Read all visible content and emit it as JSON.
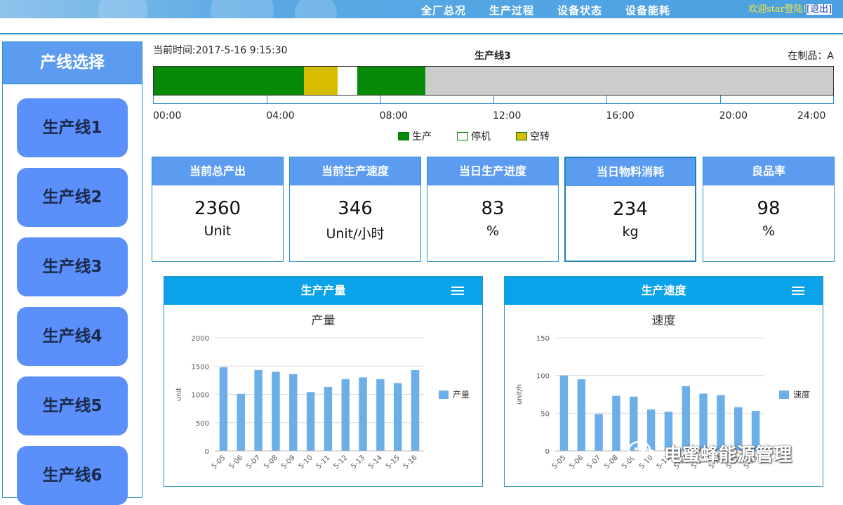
{
  "topbar": {
    "nav": [
      "全厂总况",
      "生产过程",
      "设备状态",
      "设备能耗"
    ],
    "welcome": "欢迎star登陆!",
    "logout": "[退出]"
  },
  "sidebar": {
    "title": "产线选择",
    "lines": [
      "生产线1",
      "生产线2",
      "生产线3",
      "生产线4",
      "生产线5",
      "生产线6"
    ]
  },
  "status": {
    "current_time": "当前时间:2017-5-16 9:15:30",
    "line_title": "生产线3",
    "wip": "在制品：A"
  },
  "timeline": {
    "ticks": [
      "00:00",
      "04:00",
      "08:00",
      "12:00",
      "16:00",
      "20:00",
      "24:00"
    ],
    "segments": [
      {
        "state": "生产",
        "start_h": 0.0,
        "end_h": 5.3
      },
      {
        "state": "空转",
        "start_h": 5.3,
        "end_h": 6.5
      },
      {
        "state": "停机",
        "start_h": 6.5,
        "end_h": 7.2
      },
      {
        "state": "生产",
        "start_h": 7.2,
        "end_h": 9.6
      }
    ],
    "legend": [
      {
        "label": "生产",
        "color": "#078a07"
      },
      {
        "label": "停机",
        "color": "#ffffff"
      },
      {
        "label": "空转",
        "color": "#d6bd00"
      }
    ]
  },
  "kpis": [
    {
      "title": "当前总产出",
      "value": "2360",
      "unit": "Unit"
    },
    {
      "title": "当前生产速度",
      "value": "346",
      "unit": "Unit/小时"
    },
    {
      "title": "当日生产进度",
      "value": "83",
      "unit": "%"
    },
    {
      "title": "当日物料消耗",
      "value": "234",
      "unit": "kg"
    },
    {
      "title": "良品率",
      "value": "98",
      "unit": "%"
    }
  ],
  "panels": [
    {
      "header": "生产产量"
    },
    {
      "header": "生产速度"
    }
  ],
  "chart_data": [
    {
      "type": "bar",
      "title": "产量",
      "ylabel": "unit",
      "ylim": [
        0,
        2000
      ],
      "yticks": [
        0,
        500,
        1000,
        1500,
        2000
      ],
      "categories": [
        "5-05",
        "5-06",
        "5-07",
        "5-08",
        "5-09",
        "5-10",
        "5-11",
        "5-12",
        "5-13",
        "5-14",
        "5-15",
        "5-16"
      ],
      "series": [
        {
          "name": "产量",
          "color": "#6caee8",
          "values": [
            1480,
            1010,
            1430,
            1400,
            1360,
            1040,
            1130,
            1270,
            1300,
            1270,
            1200,
            1430
          ]
        }
      ],
      "grid": true,
      "legend": "right"
    },
    {
      "type": "bar",
      "title": "速度",
      "ylabel": "unit/h",
      "ylim": [
        0,
        150
      ],
      "yticks": [
        0,
        50,
        100,
        150
      ],
      "categories": [
        "5-05",
        "5-06",
        "5-07",
        "5-08",
        "5-09",
        "5-10",
        "5-11",
        "5-12",
        "5-13",
        "5-14",
        "5-15",
        "5-16"
      ],
      "series": [
        {
          "name": "速度",
          "color": "#6caee8",
          "values": [
            100,
            95,
            49,
            73,
            72,
            55,
            52,
            86,
            76,
            74,
            58,
            53
          ]
        }
      ],
      "grid": true,
      "legend": "right"
    }
  ],
  "watermark": "电蜜蜂能源管理"
}
